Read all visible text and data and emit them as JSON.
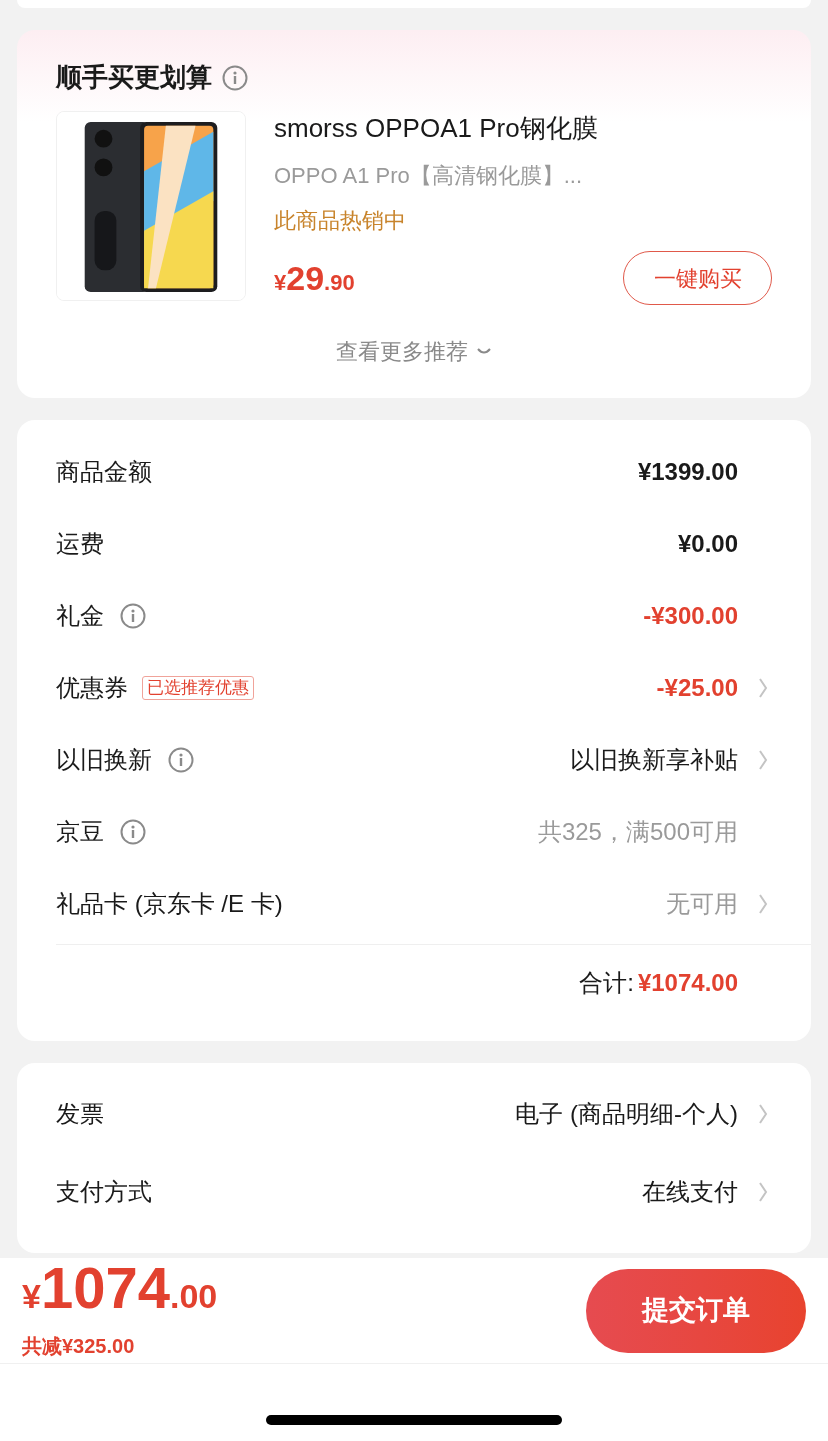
{
  "recommend": {
    "title": "顺手买更划算",
    "product": {
      "kind": "picture",
      "name": "smorss OPPOA1 Pro钢化膜",
      "subtitle": "OPPO A1 Pro【高清钢化膜】...",
      "tag": "此商品热销中",
      "price": {
        "currency": "¥",
        "integer": "29",
        "decimal": ".90"
      },
      "buy_button": "一键购买"
    },
    "more": "查看更多推荐"
  },
  "summary": {
    "rows": [
      {
        "kind": "amount",
        "label": "商品金额",
        "info": false,
        "value": "¥1399.00",
        "chevron": false
      },
      {
        "kind": "amount",
        "label": "运费",
        "info": false,
        "value": "¥0.00",
        "chevron": false
      },
      {
        "kind": "deduction",
        "label": "礼金",
        "info": true,
        "value": "-¥300.00",
        "chevron": false
      },
      {
        "kind": "deduction",
        "label": "优惠券",
        "info": false,
        "badge": "已选推荐优惠",
        "value": "-¥25.00",
        "chevron": true
      },
      {
        "kind": "option",
        "label": "以旧换新",
        "info": true,
        "value": "以旧换新享补贴",
        "chevron": true
      },
      {
        "kind": "unavailable",
        "label": "京豆",
        "info": true,
        "value": "共325，满500可用",
        "chevron": false
      },
      {
        "kind": "unavailable",
        "label": "礼品卡 (京东卡 /E 卡)",
        "info": false,
        "value": "无可用",
        "chevron": true
      }
    ],
    "total": {
      "label": "合计:",
      "value": "¥1074.00"
    }
  },
  "options": [
    {
      "label": "发票",
      "value": "电子 (商品明细-个人)"
    },
    {
      "label": "支付方式",
      "value": "在线支付"
    }
  ],
  "footer": {
    "price": {
      "currency": "¥",
      "integer": "1074",
      "decimal": ".00"
    },
    "discount": "共减¥325.00",
    "submit": "提交订单"
  }
}
